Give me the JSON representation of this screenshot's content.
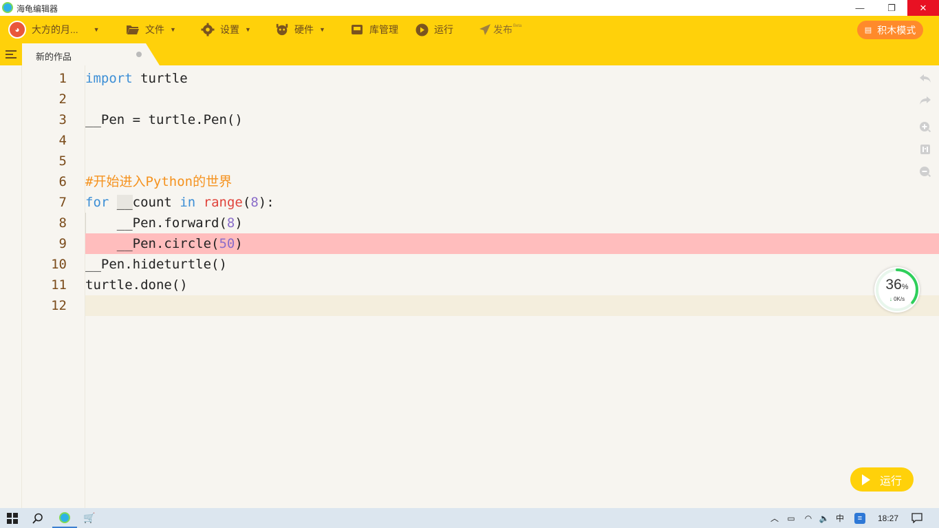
{
  "window": {
    "title": "海龟编辑器",
    "minimize_glyph": "—",
    "restore_glyph": "❐",
    "close_glyph": "✕"
  },
  "toolbar": {
    "user_name": "大方的月...",
    "file_label": "文件",
    "settings_label": "设置",
    "hardware_label": "硬件",
    "library_label": "库管理",
    "run_label": "运行",
    "publish_label": "发布",
    "publish_badge": "Beta",
    "block_mode_label": "积木模式"
  },
  "tabs": [
    {
      "label": "新的作品"
    }
  ],
  "editor": {
    "line_numbers": [
      "1",
      "2",
      "3",
      "4",
      "5",
      "6",
      "7",
      "8",
      "9",
      "10",
      "11",
      "12"
    ],
    "error_line": 9,
    "current_line": 12
  },
  "speed_widget": {
    "percent": "36",
    "percent_sign": "%",
    "rate": "0K/s",
    "level": 0.36
  },
  "run_button": {
    "label": "运行"
  },
  "taskbar": {
    "time": "18:27",
    "ime_label": "中"
  },
  "colors": {
    "accent": "#ffd10a",
    "keyword": "#3d8fd6",
    "builtin": "#e0443c",
    "number": "#8a6cc9",
    "comment": "#f5921e",
    "error_line_bg": "#ffbdbd"
  }
}
